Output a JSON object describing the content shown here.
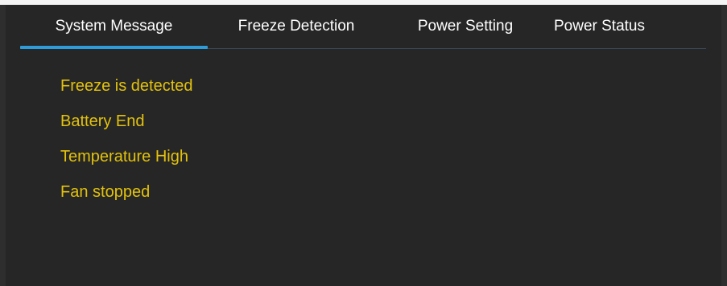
{
  "tabs": [
    {
      "label": "System Message",
      "active": true
    },
    {
      "label": "Freeze Detection",
      "active": false
    },
    {
      "label": "Power Setting",
      "active": false
    },
    {
      "label": "Power Status",
      "active": false
    }
  ],
  "messages": [
    "Freeze is detected",
    "Battery End",
    "Temperature High",
    "Fan stopped"
  ],
  "colors": {
    "background": "#262626",
    "message_text": "#e3c20c",
    "tab_text": "#ffffff",
    "active_tab_underline": "#2d9cdb"
  }
}
